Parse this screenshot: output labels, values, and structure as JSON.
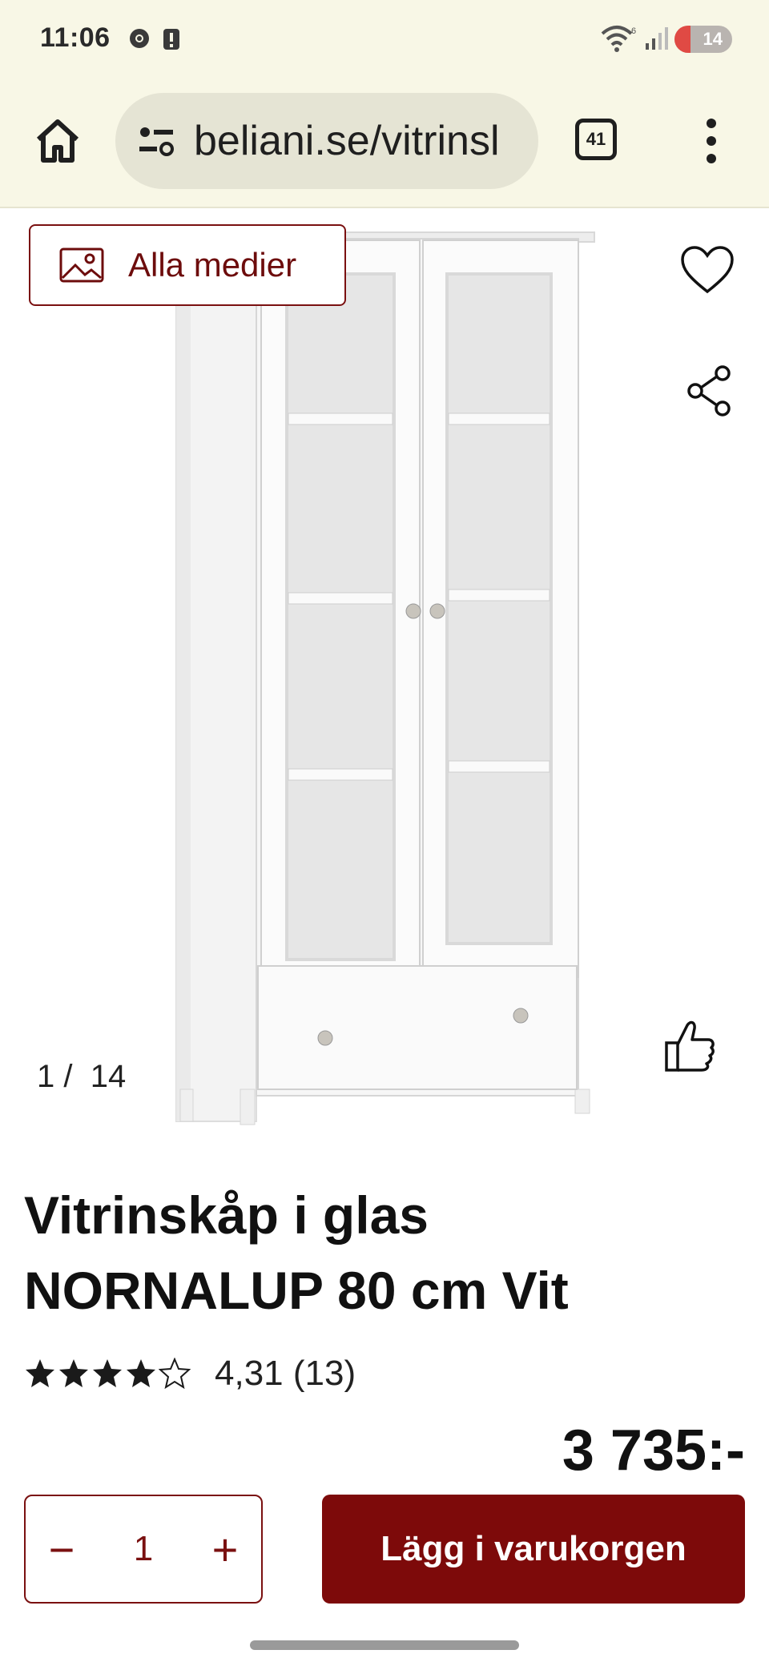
{
  "status": {
    "time": "11:06",
    "battery": "14"
  },
  "browser": {
    "url": "beliani.se/vitrinsl",
    "tab_count": "41"
  },
  "gallery": {
    "media_button_label": "Alla medier",
    "current": "1",
    "separator": "/",
    "total": "14"
  },
  "product": {
    "title_line1": "Vitrinskåp i glas",
    "title_line2": "NORNALUP 80 cm Vit",
    "rating_value": 4.31,
    "rating_text": "4,31",
    "review_count": "(13)",
    "stars_max": 5,
    "price": "3 735:-"
  },
  "cart": {
    "quantity": "1",
    "minus_label": "−",
    "plus_label": "+",
    "add_label": "Lägg i varukorgen"
  },
  "colors": {
    "brand": "#7d0a0a",
    "chrome_bg": "#f8f7e6"
  },
  "icons": [
    "home-icon",
    "site-settings-icon",
    "tabs-icon",
    "more-icon",
    "image-icon",
    "heart-icon",
    "share-icon",
    "thumbs-up-icon",
    "star-icon"
  ]
}
